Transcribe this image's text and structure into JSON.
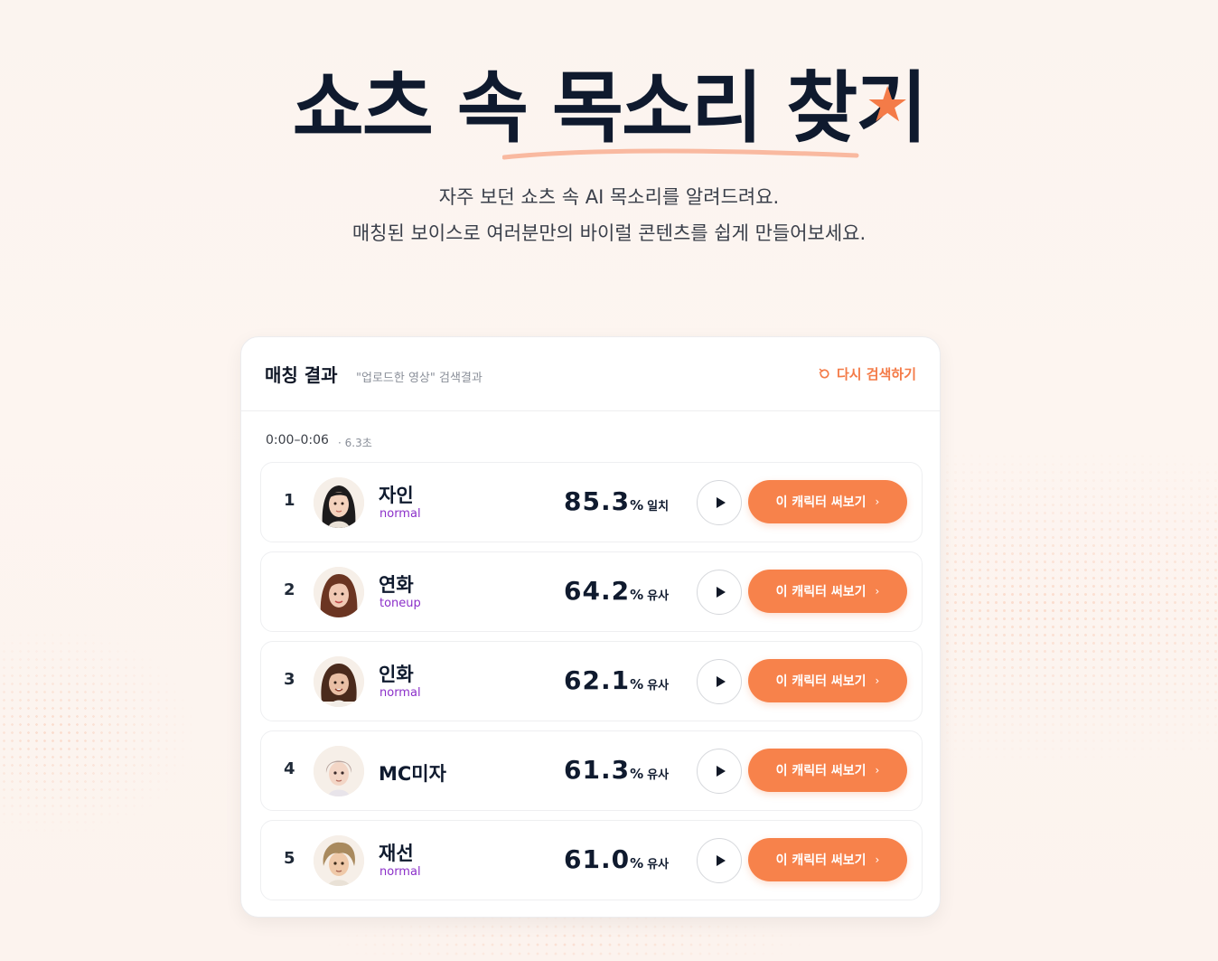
{
  "hero": {
    "title_part1": "쇼츠 속 ",
    "title_highlight": "목소리 찾기",
    "star": "★",
    "subtitle_line1": "자주 보던 쇼츠 속 AI 목소리를 알려드려요.",
    "subtitle_line2": "매칭된 보이스로 여러분만의 바이럴 콘텐츠를 쉽게 만들어보세요."
  },
  "card": {
    "title": "매칭 결과",
    "subtitle": "\"업로드한 영상\" 검색결과",
    "retry_label": "다시 검색하기",
    "retry_icon": "refresh-icon",
    "segment_range": "0:00–0:06",
    "segment_duration": "· 6.3초"
  },
  "results": [
    {
      "rank": "1",
      "name": "자인",
      "style": "normal",
      "score": "85.3",
      "pct": "%",
      "level": "일치",
      "cta": "이 캐릭터 써보기",
      "chev": "›",
      "avatar": "woman-black-hair"
    },
    {
      "rank": "2",
      "name": "연화",
      "style": "toneup",
      "score": "64.2",
      "pct": "%",
      "level": "유사",
      "cta": "이 캐릭터 써보기",
      "chev": "›",
      "avatar": "woman-brown-hair"
    },
    {
      "rank": "3",
      "name": "인화",
      "style": "normal",
      "score": "62.1",
      "pct": "%",
      "level": "유사",
      "cta": "이 캐릭터 써보기",
      "chev": "›",
      "avatar": "woman-dark-brown-hair"
    },
    {
      "rank": "4",
      "name": "MC미자",
      "style": "",
      "score": "61.3",
      "pct": "%",
      "level": "유사",
      "cta": "이 캐릭터 써보기",
      "chev": "›",
      "avatar": "man-light-hair"
    },
    {
      "rank": "5",
      "name": "재선",
      "style": "normal",
      "score": "61.0",
      "pct": "%",
      "level": "유사",
      "cta": "이 캐릭터 써보기",
      "chev": "›",
      "avatar": "man-wavy-hair"
    }
  ],
  "colors": {
    "accent": "#f7824b",
    "title": "#0f1a2e",
    "style_tag": "#8b2fc9",
    "underline": "#f9b9a0"
  }
}
